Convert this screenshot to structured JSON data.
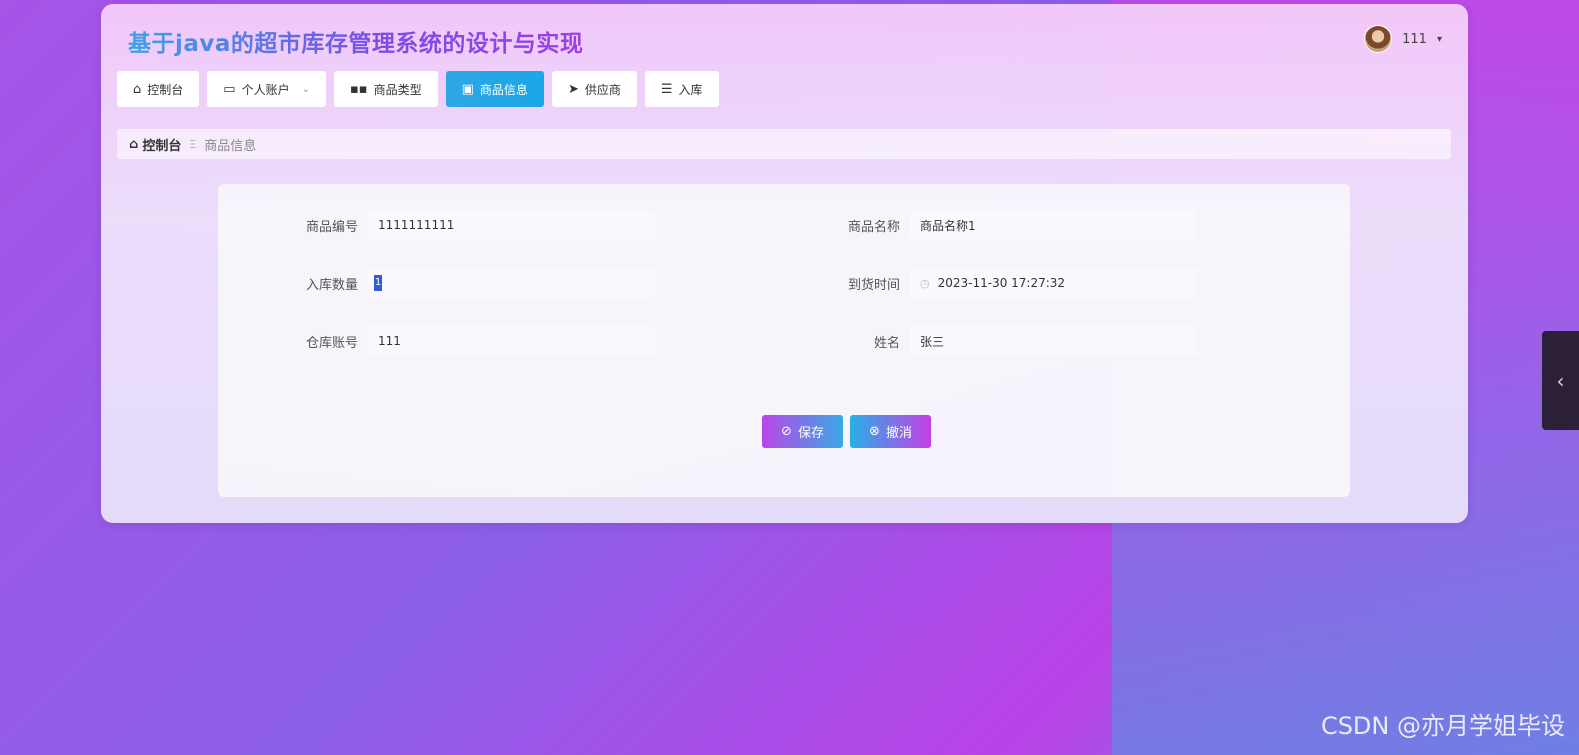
{
  "app": {
    "title": "基于java的超市库存管理系统的设计与实现"
  },
  "user": {
    "name": "111",
    "caret": "▾"
  },
  "nav": {
    "items": [
      {
        "label": "控制台",
        "icon": "home-icon"
      },
      {
        "label": "个人账户",
        "icon": "wallet-icon",
        "has_dropdown": true
      },
      {
        "label": "商品类型",
        "icon": "grid-icon"
      },
      {
        "label": "商品信息",
        "icon": "clipboard-icon",
        "active": true
      },
      {
        "label": "供应商",
        "icon": "send-icon"
      },
      {
        "label": "入库",
        "icon": "sliders-icon"
      }
    ]
  },
  "breadcrumb": {
    "home": "控制台",
    "separator": "Ξ",
    "current": "商品信息"
  },
  "form": {
    "product_code": {
      "label": "商品编号",
      "value": "1111111111"
    },
    "product_name": {
      "label": "商品名称",
      "value": "商品名称1"
    },
    "quantity": {
      "label": "入库数量",
      "value": "1"
    },
    "arrival_time": {
      "label": "到货时间",
      "value": "2023-11-30 17:27:32"
    },
    "warehouse_account": {
      "label": "仓库账号",
      "value": "111"
    },
    "name": {
      "label": "姓名",
      "value": "张三"
    }
  },
  "buttons": {
    "save": "保存",
    "cancel": "撤消"
  },
  "side_tab": {
    "icon": "chevron-left-icon",
    "glyph": "‹"
  },
  "watermark": "CSDN @亦月学姐毕设",
  "colors": {
    "active_nav": "#1aa7e8",
    "save_button": "#b946e6",
    "cancel_button": "#c43fe6"
  }
}
